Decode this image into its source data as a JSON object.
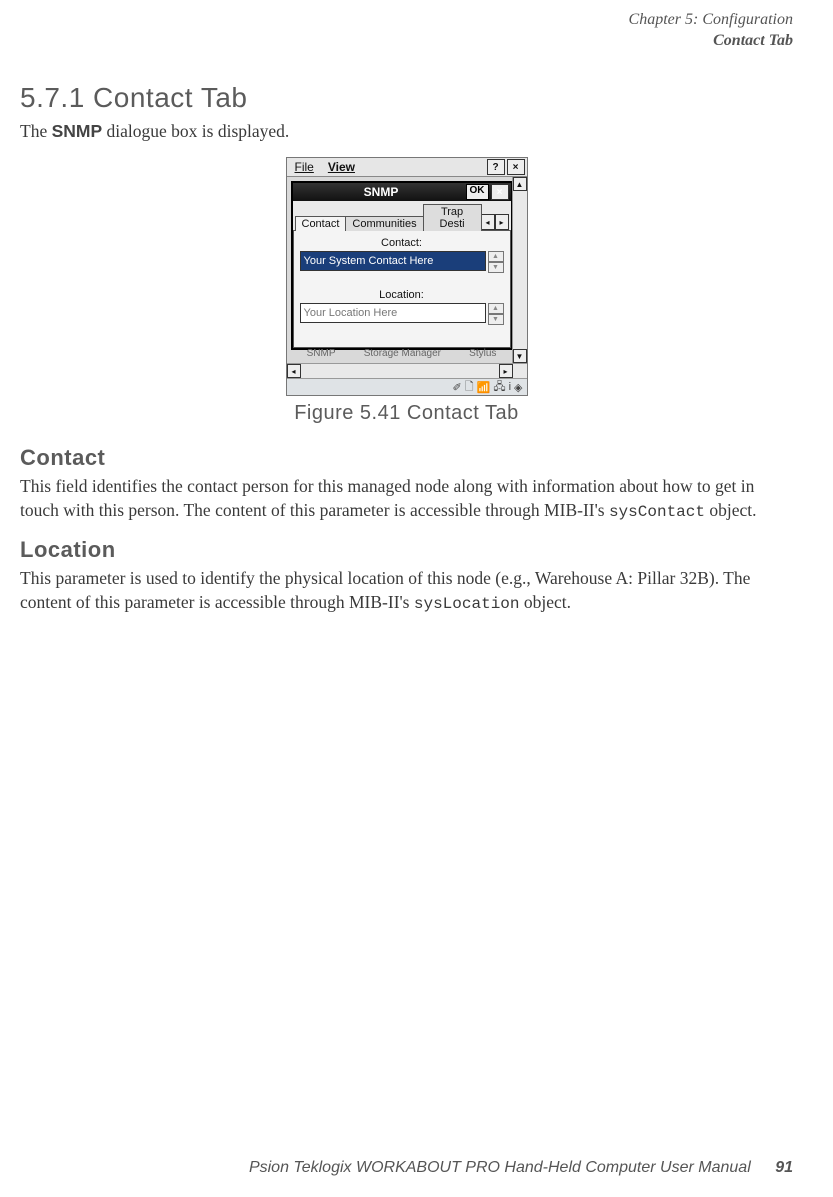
{
  "header": {
    "line1": "Chapter 5: Configuration",
    "line2": "Contact Tab"
  },
  "section": {
    "number_title": "5.7.1  Contact Tab",
    "intro_pre": "The ",
    "intro_bold": "SNMP",
    "intro_post": " dialogue box is displayed."
  },
  "figure": {
    "caption": "Figure 5.41 Contact Tab"
  },
  "device": {
    "menu": {
      "file": "File",
      "view": "View",
      "help": "?",
      "close": "×"
    },
    "snmp": {
      "title": "SNMP",
      "ok": "OK",
      "close": "×",
      "tabs": {
        "contact": "Contact",
        "communities": "Communities",
        "trap": "Trap Desti"
      },
      "contact_label": "Contact:",
      "contact_value": "Your System Contact Here",
      "location_label": "Location:",
      "location_value": "Your Location Here"
    },
    "desktop": {
      "a": "SNMP",
      "b": "Storage Manager",
      "c": "Stylus"
    },
    "tray": {
      "i1": "✐",
      "i2": "🗋",
      "i3": "📶",
      "i4": "🖧",
      "i5": "i",
      "i6": "◈"
    }
  },
  "contact_section": {
    "heading": "Contact",
    "p_pre": "This field identifies the contact person for this managed node along with information about how to get in touch with this person. The content of this parameter is accessible through MIB-II's ",
    "code": "sysContact",
    "p_post": " object."
  },
  "location_section": {
    "heading": "Location",
    "p_pre": "This parameter is used to identify the physical location of this node (e.g., Warehouse A: Pillar 32B). The content of this parameter is accessible through MIB-II's ",
    "code": "sysLocation",
    "p_post": " object."
  },
  "footer": {
    "text": "Psion Teklogix WORKABOUT PRO Hand-Held Computer User Manual",
    "page": "91"
  }
}
